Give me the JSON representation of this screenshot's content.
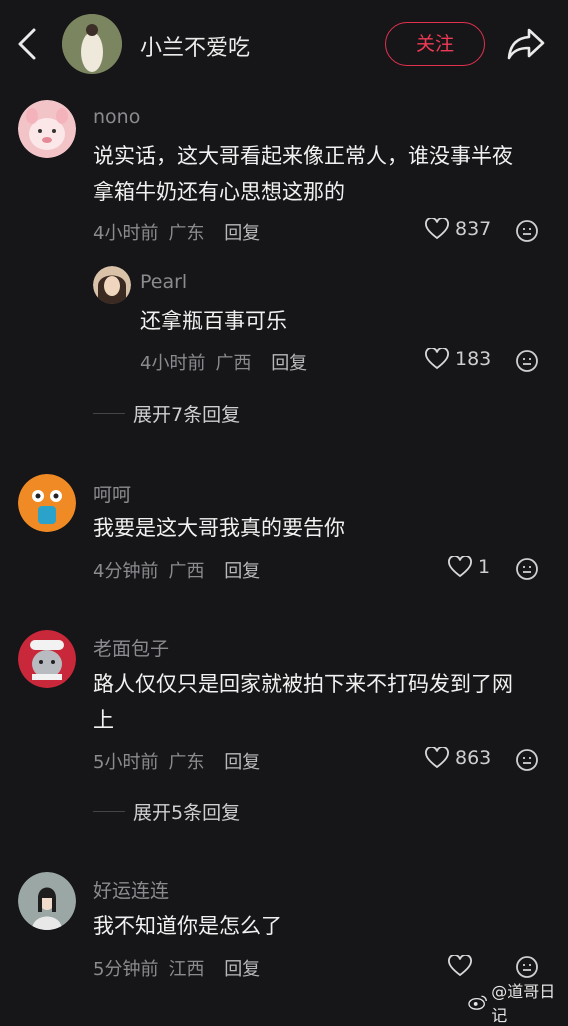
{
  "header": {
    "username": "小兰不爱吃",
    "follow_label": "关注"
  },
  "comments": [
    {
      "username": "nono",
      "text_line1": "说实话，这大哥看起来像正常人，谁没事半夜",
      "text_line2": "拿箱牛奶还有心思想这那的",
      "time": "4小时前",
      "location": "广东",
      "reply_label": "回复",
      "likes": "837",
      "sub_reply": {
        "username": "Pearl",
        "text": "还拿瓶百事可乐",
        "time": "4小时前",
        "location": "广西",
        "reply_label": "回复",
        "likes": "183"
      },
      "expand_label": "展开7条回复"
    },
    {
      "username": "呵呵",
      "text_line1": "我要是这大哥我真的要告你",
      "time": "4分钟前",
      "location": "广西",
      "reply_label": "回复",
      "likes": "1"
    },
    {
      "username": "老面包子",
      "text_line1": "路人仅仅只是回家就被拍下来不打码发到了网",
      "text_line2": "上",
      "time": "5小时前",
      "location": "广东",
      "reply_label": "回复",
      "likes": "863",
      "expand_label": "展开5条回复"
    },
    {
      "username": "好运连连",
      "text_line1": "我不知道你是怎么了",
      "time": "5分钟前",
      "location": "江西",
      "reply_label": "回复",
      "likes": ""
    }
  ],
  "watermark": {
    "text": "@道哥日记"
  },
  "colors": {
    "background": "#161618",
    "follow_red": "#e1314d",
    "muted": "#8b8b8f"
  }
}
